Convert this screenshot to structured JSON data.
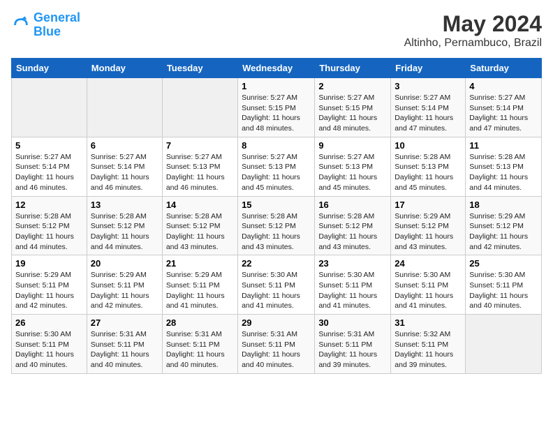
{
  "logo": {
    "line1": "General",
    "line2": "Blue"
  },
  "title": "May 2024",
  "subtitle": "Altinho, Pernambuco, Brazil",
  "days_of_week": [
    "Sunday",
    "Monday",
    "Tuesday",
    "Wednesday",
    "Thursday",
    "Friday",
    "Saturday"
  ],
  "weeks": [
    [
      {
        "day": "",
        "info": ""
      },
      {
        "day": "",
        "info": ""
      },
      {
        "day": "",
        "info": ""
      },
      {
        "day": "1",
        "info": "Sunrise: 5:27 AM\nSunset: 5:15 PM\nDaylight: 11 hours and 48 minutes."
      },
      {
        "day": "2",
        "info": "Sunrise: 5:27 AM\nSunset: 5:15 PM\nDaylight: 11 hours and 48 minutes."
      },
      {
        "day": "3",
        "info": "Sunrise: 5:27 AM\nSunset: 5:14 PM\nDaylight: 11 hours and 47 minutes."
      },
      {
        "day": "4",
        "info": "Sunrise: 5:27 AM\nSunset: 5:14 PM\nDaylight: 11 hours and 47 minutes."
      }
    ],
    [
      {
        "day": "5",
        "info": "Sunrise: 5:27 AM\nSunset: 5:14 PM\nDaylight: 11 hours and 46 minutes."
      },
      {
        "day": "6",
        "info": "Sunrise: 5:27 AM\nSunset: 5:14 PM\nDaylight: 11 hours and 46 minutes."
      },
      {
        "day": "7",
        "info": "Sunrise: 5:27 AM\nSunset: 5:13 PM\nDaylight: 11 hours and 46 minutes."
      },
      {
        "day": "8",
        "info": "Sunrise: 5:27 AM\nSunset: 5:13 PM\nDaylight: 11 hours and 45 minutes."
      },
      {
        "day": "9",
        "info": "Sunrise: 5:27 AM\nSunset: 5:13 PM\nDaylight: 11 hours and 45 minutes."
      },
      {
        "day": "10",
        "info": "Sunrise: 5:28 AM\nSunset: 5:13 PM\nDaylight: 11 hours and 45 minutes."
      },
      {
        "day": "11",
        "info": "Sunrise: 5:28 AM\nSunset: 5:13 PM\nDaylight: 11 hours and 44 minutes."
      }
    ],
    [
      {
        "day": "12",
        "info": "Sunrise: 5:28 AM\nSunset: 5:12 PM\nDaylight: 11 hours and 44 minutes."
      },
      {
        "day": "13",
        "info": "Sunrise: 5:28 AM\nSunset: 5:12 PM\nDaylight: 11 hours and 44 minutes."
      },
      {
        "day": "14",
        "info": "Sunrise: 5:28 AM\nSunset: 5:12 PM\nDaylight: 11 hours and 43 minutes."
      },
      {
        "day": "15",
        "info": "Sunrise: 5:28 AM\nSunset: 5:12 PM\nDaylight: 11 hours and 43 minutes."
      },
      {
        "day": "16",
        "info": "Sunrise: 5:28 AM\nSunset: 5:12 PM\nDaylight: 11 hours and 43 minutes."
      },
      {
        "day": "17",
        "info": "Sunrise: 5:29 AM\nSunset: 5:12 PM\nDaylight: 11 hours and 43 minutes."
      },
      {
        "day": "18",
        "info": "Sunrise: 5:29 AM\nSunset: 5:12 PM\nDaylight: 11 hours and 42 minutes."
      }
    ],
    [
      {
        "day": "19",
        "info": "Sunrise: 5:29 AM\nSunset: 5:11 PM\nDaylight: 11 hours and 42 minutes."
      },
      {
        "day": "20",
        "info": "Sunrise: 5:29 AM\nSunset: 5:11 PM\nDaylight: 11 hours and 42 minutes."
      },
      {
        "day": "21",
        "info": "Sunrise: 5:29 AM\nSunset: 5:11 PM\nDaylight: 11 hours and 41 minutes."
      },
      {
        "day": "22",
        "info": "Sunrise: 5:30 AM\nSunset: 5:11 PM\nDaylight: 11 hours and 41 minutes."
      },
      {
        "day": "23",
        "info": "Sunrise: 5:30 AM\nSunset: 5:11 PM\nDaylight: 11 hours and 41 minutes."
      },
      {
        "day": "24",
        "info": "Sunrise: 5:30 AM\nSunset: 5:11 PM\nDaylight: 11 hours and 41 minutes."
      },
      {
        "day": "25",
        "info": "Sunrise: 5:30 AM\nSunset: 5:11 PM\nDaylight: 11 hours and 40 minutes."
      }
    ],
    [
      {
        "day": "26",
        "info": "Sunrise: 5:30 AM\nSunset: 5:11 PM\nDaylight: 11 hours and 40 minutes."
      },
      {
        "day": "27",
        "info": "Sunrise: 5:31 AM\nSunset: 5:11 PM\nDaylight: 11 hours and 40 minutes."
      },
      {
        "day": "28",
        "info": "Sunrise: 5:31 AM\nSunset: 5:11 PM\nDaylight: 11 hours and 40 minutes."
      },
      {
        "day": "29",
        "info": "Sunrise: 5:31 AM\nSunset: 5:11 PM\nDaylight: 11 hours and 40 minutes."
      },
      {
        "day": "30",
        "info": "Sunrise: 5:31 AM\nSunset: 5:11 PM\nDaylight: 11 hours and 39 minutes."
      },
      {
        "day": "31",
        "info": "Sunrise: 5:32 AM\nSunset: 5:11 PM\nDaylight: 11 hours and 39 minutes."
      },
      {
        "day": "",
        "info": ""
      }
    ]
  ]
}
